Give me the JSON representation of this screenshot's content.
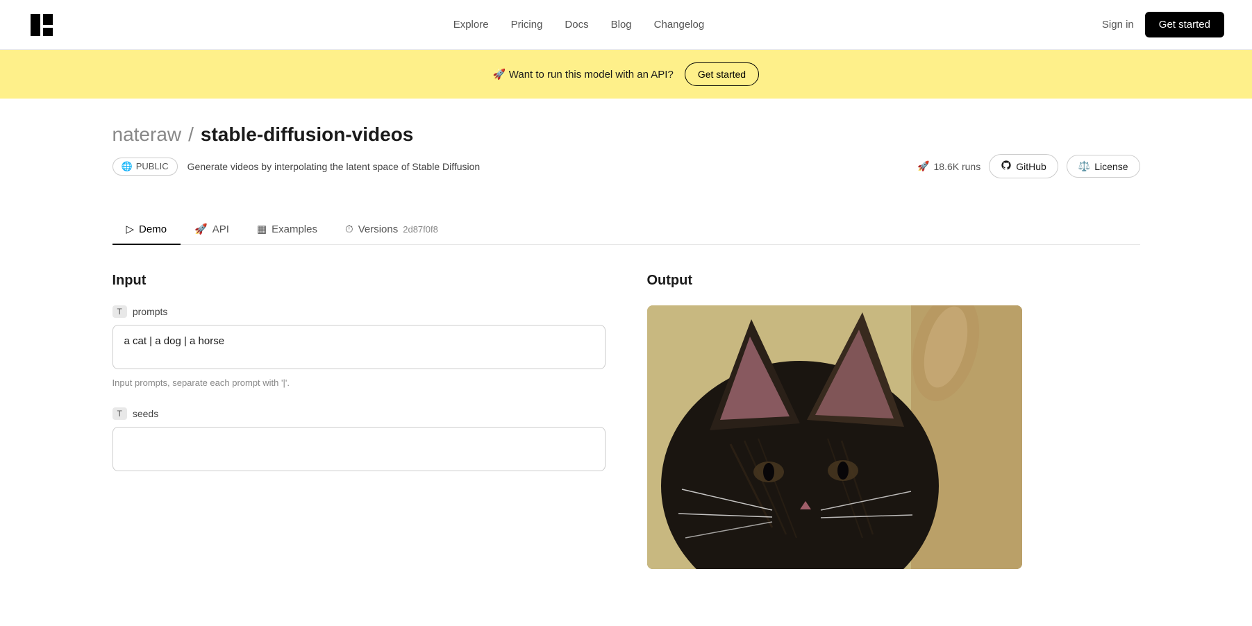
{
  "nav": {
    "logo_alt": "Replicate logo",
    "links": [
      {
        "label": "Explore",
        "href": "#"
      },
      {
        "label": "Pricing",
        "href": "#"
      },
      {
        "label": "Docs",
        "href": "#"
      },
      {
        "label": "Blog",
        "href": "#"
      },
      {
        "label": "Changelog",
        "href": "#"
      }
    ],
    "signin_label": "Sign in",
    "get_started_label": "Get started"
  },
  "banner": {
    "emoji": "🚀",
    "text": "Want to run this model with an API?",
    "cta_label": "Get started"
  },
  "model": {
    "author": "nateraw",
    "separator": "/",
    "name": "stable-diffusion-videos",
    "visibility": "PUBLIC",
    "description": "Generate videos by interpolating the latent space of Stable Diffusion",
    "runs": "18.6K runs",
    "github_label": "GitHub",
    "license_label": "License"
  },
  "tabs": [
    {
      "label": "Demo",
      "icon": "play-icon",
      "active": true
    },
    {
      "label": "API",
      "icon": "rocket-icon",
      "active": false
    },
    {
      "label": "Examples",
      "icon": "grid-icon",
      "active": false
    },
    {
      "label": "Versions",
      "icon": "clock-icon",
      "active": false,
      "hash": "2d87f0f8"
    }
  ],
  "input": {
    "title": "Input",
    "fields": [
      {
        "type": "T",
        "name": "prompts",
        "value": "a cat | a dog | a horse",
        "hint": "Input prompts, separate each prompt with '|'.",
        "placeholder": ""
      },
      {
        "type": "T",
        "name": "seeds",
        "value": "",
        "hint": "",
        "placeholder": ""
      }
    ]
  },
  "output": {
    "title": "Output"
  }
}
